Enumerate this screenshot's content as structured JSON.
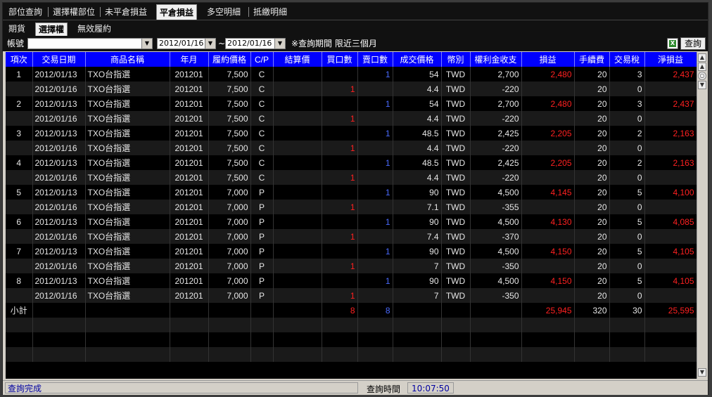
{
  "tabs": [
    "部位查詢",
    "選擇權部位",
    "未平倉損益",
    "平倉損益",
    "多空明細",
    "抵繳明細"
  ],
  "active_tab": 3,
  "subtabs": [
    "期貨",
    "選擇權",
    "無效履約"
  ],
  "active_subtab": 1,
  "query": {
    "account_label": "帳號",
    "account_value": "",
    "date_from": "2012/01/16",
    "date_to": "2012/01/16",
    "tilde": "~",
    "period_note": "※查詢期間 限近三個月",
    "query_button": "查詢",
    "excel_icon": "X"
  },
  "columns": [
    "項次",
    "交易日期",
    "商品名稱",
    "年月",
    "履約價格",
    "C/P",
    "結算價",
    "買口數",
    "賣口數",
    "成交價格",
    "幣別",
    "權利金收支",
    "損益",
    "手續費",
    "交易稅",
    "淨損益"
  ],
  "rows": [
    [
      "1",
      "2012/01/13",
      "TXO台指選",
      "201201",
      "7,500",
      "C",
      "",
      "",
      "1",
      "54",
      "TWD",
      "2,700",
      "2,480",
      "20",
      "3",
      "2,437"
    ],
    [
      "",
      "2012/01/16",
      "TXO台指選",
      "201201",
      "7,500",
      "C",
      "",
      "1",
      "",
      "4.4",
      "TWD",
      "-220",
      "",
      "20",
      "0",
      ""
    ],
    [
      "2",
      "2012/01/13",
      "TXO台指選",
      "201201",
      "7,500",
      "C",
      "",
      "",
      "1",
      "54",
      "TWD",
      "2,700",
      "2,480",
      "20",
      "3",
      "2,437"
    ],
    [
      "",
      "2012/01/16",
      "TXO台指選",
      "201201",
      "7,500",
      "C",
      "",
      "1",
      "",
      "4.4",
      "TWD",
      "-220",
      "",
      "20",
      "0",
      ""
    ],
    [
      "3",
      "2012/01/13",
      "TXO台指選",
      "201201",
      "7,500",
      "C",
      "",
      "",
      "1",
      "48.5",
      "TWD",
      "2,425",
      "2,205",
      "20",
      "2",
      "2,163"
    ],
    [
      "",
      "2012/01/16",
      "TXO台指選",
      "201201",
      "7,500",
      "C",
      "",
      "1",
      "",
      "4.4",
      "TWD",
      "-220",
      "",
      "20",
      "0",
      ""
    ],
    [
      "4",
      "2012/01/13",
      "TXO台指選",
      "201201",
      "7,500",
      "C",
      "",
      "",
      "1",
      "48.5",
      "TWD",
      "2,425",
      "2,205",
      "20",
      "2",
      "2,163"
    ],
    [
      "",
      "2012/01/16",
      "TXO台指選",
      "201201",
      "7,500",
      "C",
      "",
      "1",
      "",
      "4.4",
      "TWD",
      "-220",
      "",
      "20",
      "0",
      ""
    ],
    [
      "5",
      "2012/01/13",
      "TXO台指選",
      "201201",
      "7,000",
      "P",
      "",
      "",
      "1",
      "90",
      "TWD",
      "4,500",
      "4,145",
      "20",
      "5",
      "4,100"
    ],
    [
      "",
      "2012/01/16",
      "TXO台指選",
      "201201",
      "7,000",
      "P",
      "",
      "1",
      "",
      "7.1",
      "TWD",
      "-355",
      "",
      "20",
      "0",
      ""
    ],
    [
      "6",
      "2012/01/13",
      "TXO台指選",
      "201201",
      "7,000",
      "P",
      "",
      "",
      "1",
      "90",
      "TWD",
      "4,500",
      "4,130",
      "20",
      "5",
      "4,085"
    ],
    [
      "",
      "2012/01/16",
      "TXO台指選",
      "201201",
      "7,000",
      "P",
      "",
      "1",
      "",
      "7.4",
      "TWD",
      "-370",
      "",
      "20",
      "0",
      ""
    ],
    [
      "7",
      "2012/01/13",
      "TXO台指選",
      "201201",
      "7,000",
      "P",
      "",
      "",
      "1",
      "90",
      "TWD",
      "4,500",
      "4,150",
      "20",
      "5",
      "4,105"
    ],
    [
      "",
      "2012/01/16",
      "TXO台指選",
      "201201",
      "7,000",
      "P",
      "",
      "1",
      "",
      "7",
      "TWD",
      "-350",
      "",
      "20",
      "0",
      ""
    ],
    [
      "8",
      "2012/01/13",
      "TXO台指選",
      "201201",
      "7,000",
      "P",
      "",
      "",
      "1",
      "90",
      "TWD",
      "4,500",
      "4,150",
      "20",
      "5",
      "4,105"
    ],
    [
      "",
      "2012/01/16",
      "TXO台指選",
      "201201",
      "7,000",
      "P",
      "",
      "1",
      "",
      "7",
      "TWD",
      "-350",
      "",
      "20",
      "0",
      ""
    ]
  ],
  "subtotal": [
    "小計",
    "",
    "",
    "",
    "",
    "",
    "",
    "8",
    "8",
    "",
    "",
    "",
    "25,945",
    "320",
    "30",
    "25,595"
  ],
  "empty_rows": 3,
  "status": {
    "message": "查詢完成",
    "time_label": "查詢時間",
    "time_value": "10:07:50"
  },
  "colors": {
    "header_bg": "#0000ff",
    "profit": "#ff2020",
    "sell_qty": "#4a6bff",
    "buy_qty": "#ff2020"
  }
}
